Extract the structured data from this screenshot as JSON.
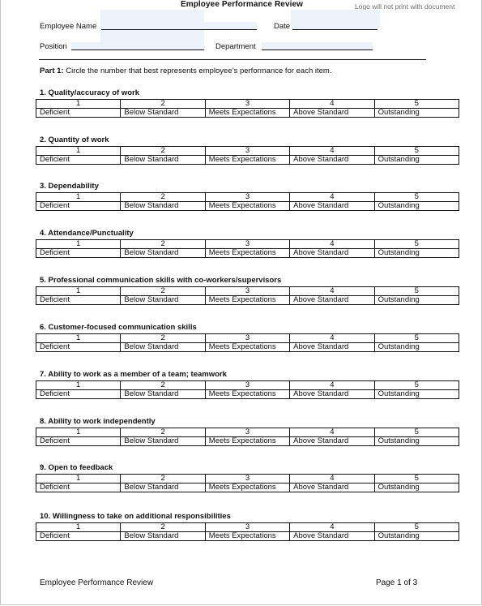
{
  "document": {
    "title": "Employee Performance Review",
    "logo_note": "Logo will not print with document"
  },
  "fields": {
    "employee_name": {
      "label": "Employee Name",
      "value": ""
    },
    "date": {
      "label": "Date",
      "value": ""
    },
    "position": {
      "label": "Position",
      "value": ""
    },
    "department": {
      "label": "Department",
      "value": ""
    }
  },
  "part1": {
    "heading": "Part 1:",
    "instruction": " Circle the number that best represents employee’s performance for each item."
  },
  "scale": {
    "numbers": [
      "1",
      "2",
      "3",
      "4",
      "5"
    ],
    "labels": [
      "Deficient",
      "Below Standard",
      "Meets Expectations",
      "Above Standard",
      "Outstanding"
    ]
  },
  "questions": [
    {
      "title": "1. Quality/accuracy of work"
    },
    {
      "title": "2. Quantity of work"
    },
    {
      "title": "3. Dependability"
    },
    {
      "title": "4. Attendance/Punctuality"
    },
    {
      "title": "5. Professional communication skills with co-workers/supervisors"
    },
    {
      "title": "6. Customer-focused communication skills"
    },
    {
      "title": "7. Ability to work as a member of a team; teamwork"
    },
    {
      "title": "8. Ability to work independently"
    },
    {
      "title": "9. Open to feedback"
    },
    {
      "title": "10. Willingness to take on additional responsibilities"
    }
  ],
  "footer": {
    "left": "Employee Performance Review",
    "right": "Page 1 of 3"
  }
}
